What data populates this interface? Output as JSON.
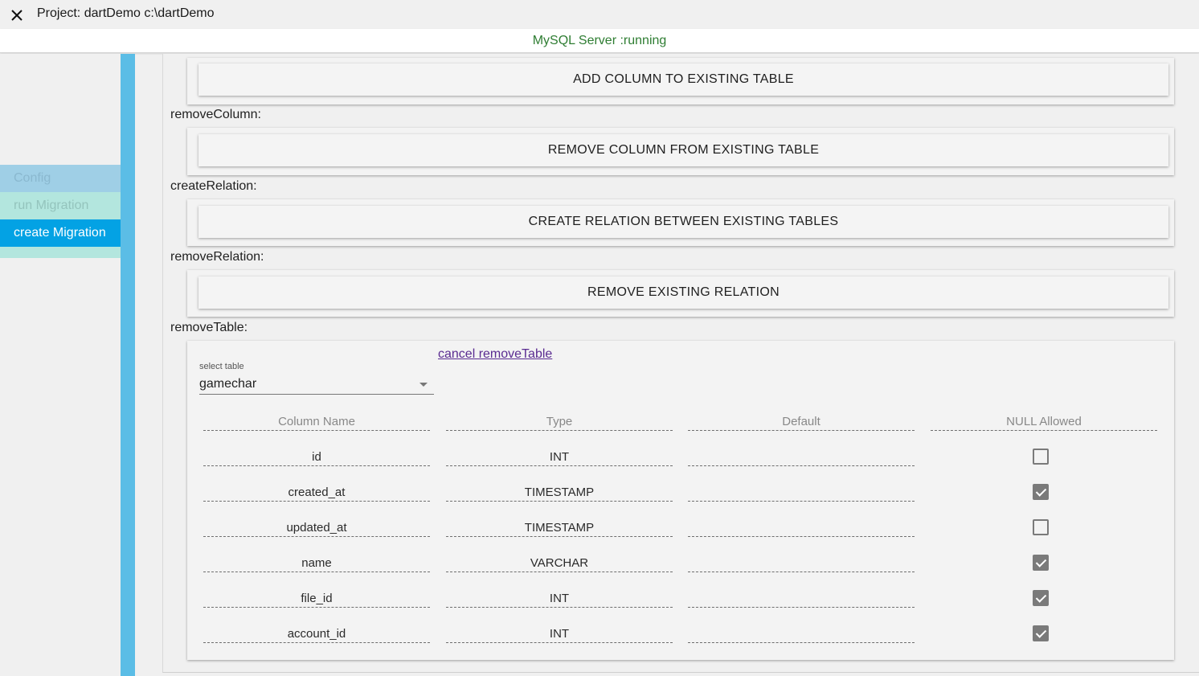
{
  "titlebar": {
    "title": "Project: dartDemo c:\\dartDemo"
  },
  "status": {
    "text": "MySQL Server :running"
  },
  "sidebar": {
    "items": [
      {
        "label": "Config"
      },
      {
        "label": "run Migration"
      },
      {
        "label": "create Migration"
      }
    ]
  },
  "actions": {
    "add_column": "ADD COLUMN TO EXISTING TABLE",
    "remove_column_label": "removeColumn:",
    "remove_column": "REMOVE COLUMN FROM EXISTING TABLE",
    "create_relation_label": "createRelation:",
    "create_relation": "CREATE RELATION BETWEEN EXISTING TABLES",
    "remove_relation_label": "removeRelation:",
    "remove_relation": "REMOVE EXISTING RELATION",
    "remove_table_label": "removeTable:"
  },
  "remove_table": {
    "cancel_link": "cancel removeTable",
    "select_label": "select table",
    "selected_table": "gamechar",
    "columns": [
      "Column Name",
      "Type",
      "Default",
      "NULL Allowed"
    ],
    "rows": [
      {
        "name": "id",
        "type": "INT",
        "default": "",
        "null_allowed": false
      },
      {
        "name": "created_at",
        "type": "TIMESTAMP",
        "default": "",
        "null_allowed": true
      },
      {
        "name": "updated_at",
        "type": "TIMESTAMP",
        "default": "",
        "null_allowed": false
      },
      {
        "name": "name",
        "type": "VARCHAR",
        "default": "",
        "null_allowed": true
      },
      {
        "name": "file_id",
        "type": "INT",
        "default": "",
        "null_allowed": true
      },
      {
        "name": "account_id",
        "type": "INT",
        "default": "",
        "null_allowed": true
      }
    ]
  }
}
